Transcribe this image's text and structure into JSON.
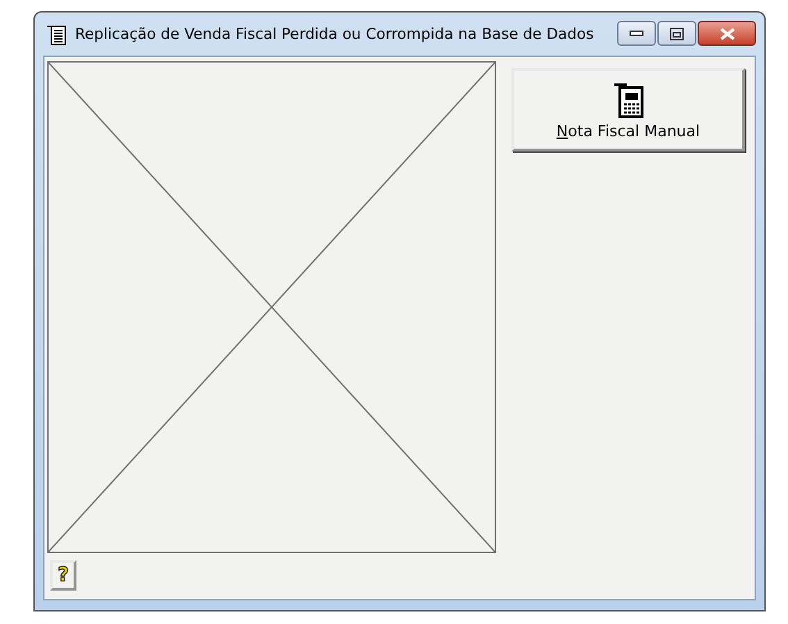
{
  "window": {
    "title": "Replicação de Venda Fiscal Perdida ou Corrompida na Base de Dados"
  },
  "manual_button": {
    "label": "Nota Fiscal Manual"
  },
  "help_button": {
    "label": "?"
  }
}
